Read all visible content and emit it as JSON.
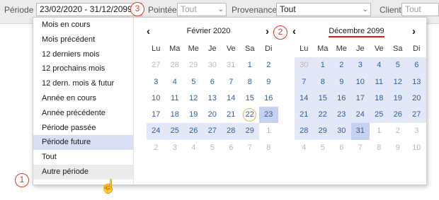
{
  "filter_bar": {
    "periode_label": "Période",
    "periode_value": "23/02/2020 - 31/12/2099",
    "pointee_label": "Pointée",
    "pointee_value": "Tout",
    "provenance_label": "Provenance",
    "provenance_value": "Tout",
    "client_label": "Client",
    "client_value": "Tout"
  },
  "menu": {
    "items": [
      {
        "label": "Mois en cours"
      },
      {
        "label": "Mois précédent"
      },
      {
        "label": "12 derniers mois"
      },
      {
        "label": "12 prochains mois"
      },
      {
        "label": "12 dern. mois & futur"
      },
      {
        "label": "Année en cours"
      },
      {
        "label": "Année précédente"
      },
      {
        "label": "Période passée"
      },
      {
        "label": "Période future",
        "state": "selected"
      },
      {
        "label": "Tout"
      },
      {
        "label": "Autre période",
        "state": "hovered"
      }
    ]
  },
  "calendars": {
    "weekdays": [
      "Lu",
      "Ma",
      "Me",
      "Je",
      "Ve",
      "Sa",
      "Di"
    ],
    "left": {
      "month": "Février 2020",
      "days": [
        {
          "n": "27",
          "out": true
        },
        {
          "n": "28",
          "out": true
        },
        {
          "n": "29",
          "out": true
        },
        {
          "n": "30",
          "out": true
        },
        {
          "n": "31",
          "out": true
        },
        {
          "n": "1"
        },
        {
          "n": "2"
        },
        {
          "n": "3"
        },
        {
          "n": "4"
        },
        {
          "n": "5"
        },
        {
          "n": "6"
        },
        {
          "n": "7"
        },
        {
          "n": "8"
        },
        {
          "n": "9"
        },
        {
          "n": "10"
        },
        {
          "n": "11"
        },
        {
          "n": "12"
        },
        {
          "n": "13"
        },
        {
          "n": "14"
        },
        {
          "n": "15"
        },
        {
          "n": "16"
        },
        {
          "n": "17"
        },
        {
          "n": "18"
        },
        {
          "n": "19"
        },
        {
          "n": "20"
        },
        {
          "n": "21"
        },
        {
          "n": "22",
          "today": true
        },
        {
          "n": "23",
          "range": "end"
        },
        {
          "n": "24",
          "range": "in"
        },
        {
          "n": "25",
          "range": "in"
        },
        {
          "n": "26",
          "range": "in"
        },
        {
          "n": "27",
          "range": "in"
        },
        {
          "n": "28",
          "range": "in"
        },
        {
          "n": "29",
          "range": "in"
        },
        {
          "n": "1",
          "out": true
        },
        {
          "n": "2",
          "out": true
        },
        {
          "n": "3",
          "out": true
        },
        {
          "n": "4",
          "out": true
        },
        {
          "n": "5",
          "out": true
        },
        {
          "n": "6",
          "out": true
        },
        {
          "n": "7",
          "out": true
        },
        {
          "n": "8",
          "out": true
        }
      ]
    },
    "right": {
      "month": "Décembre 2099",
      "days": [
        {
          "n": "30",
          "out": true,
          "range": "in"
        },
        {
          "n": "1",
          "range": "in"
        },
        {
          "n": "2",
          "range": "in"
        },
        {
          "n": "3",
          "range": "in"
        },
        {
          "n": "4",
          "range": "in"
        },
        {
          "n": "5",
          "range": "in"
        },
        {
          "n": "6",
          "range": "in"
        },
        {
          "n": "7",
          "range": "in"
        },
        {
          "n": "8",
          "range": "in"
        },
        {
          "n": "9",
          "range": "in"
        },
        {
          "n": "10",
          "range": "in"
        },
        {
          "n": "11",
          "range": "in"
        },
        {
          "n": "12",
          "range": "in"
        },
        {
          "n": "13",
          "range": "in"
        },
        {
          "n": "14",
          "range": "in"
        },
        {
          "n": "15",
          "range": "in"
        },
        {
          "n": "16",
          "range": "in"
        },
        {
          "n": "17",
          "range": "in"
        },
        {
          "n": "18",
          "range": "in"
        },
        {
          "n": "19",
          "range": "in"
        },
        {
          "n": "20",
          "range": "in"
        },
        {
          "n": "21",
          "range": "in"
        },
        {
          "n": "22",
          "range": "in"
        },
        {
          "n": "23",
          "range": "in"
        },
        {
          "n": "24",
          "range": "in"
        },
        {
          "n": "25",
          "range": "in"
        },
        {
          "n": "26",
          "range": "in"
        },
        {
          "n": "27",
          "range": "in"
        },
        {
          "n": "28",
          "range": "in"
        },
        {
          "n": "29",
          "range": "in"
        },
        {
          "n": "30",
          "range": "in"
        },
        {
          "n": "31",
          "range": "end"
        },
        {
          "n": "1",
          "out": true
        },
        {
          "n": "2",
          "out": true
        },
        {
          "n": "3",
          "out": true
        },
        {
          "n": "4",
          "out": true
        },
        {
          "n": "5",
          "out": true
        },
        {
          "n": "6",
          "out": true
        },
        {
          "n": "7",
          "out": true
        },
        {
          "n": "8",
          "out": true
        },
        {
          "n": "9",
          "out": true
        },
        {
          "n": "10",
          "out": true
        }
      ]
    }
  },
  "annotations": {
    "badge_1": "1",
    "badge_2": "2",
    "badge_3": "3"
  },
  "icons": {
    "prev": "‹",
    "next": "›",
    "dropdown": "chevron-down-icon",
    "cursor": "hand-pointer-icon"
  },
  "colors": {
    "range_bg": "#e2e8f8",
    "range_end_bg": "#c5d1f0",
    "selected_menu_bg": "#d9e0f6",
    "day_text": "#2f5d9a",
    "badge_red": "#e0342a",
    "today_ring": "#e8b83a"
  }
}
